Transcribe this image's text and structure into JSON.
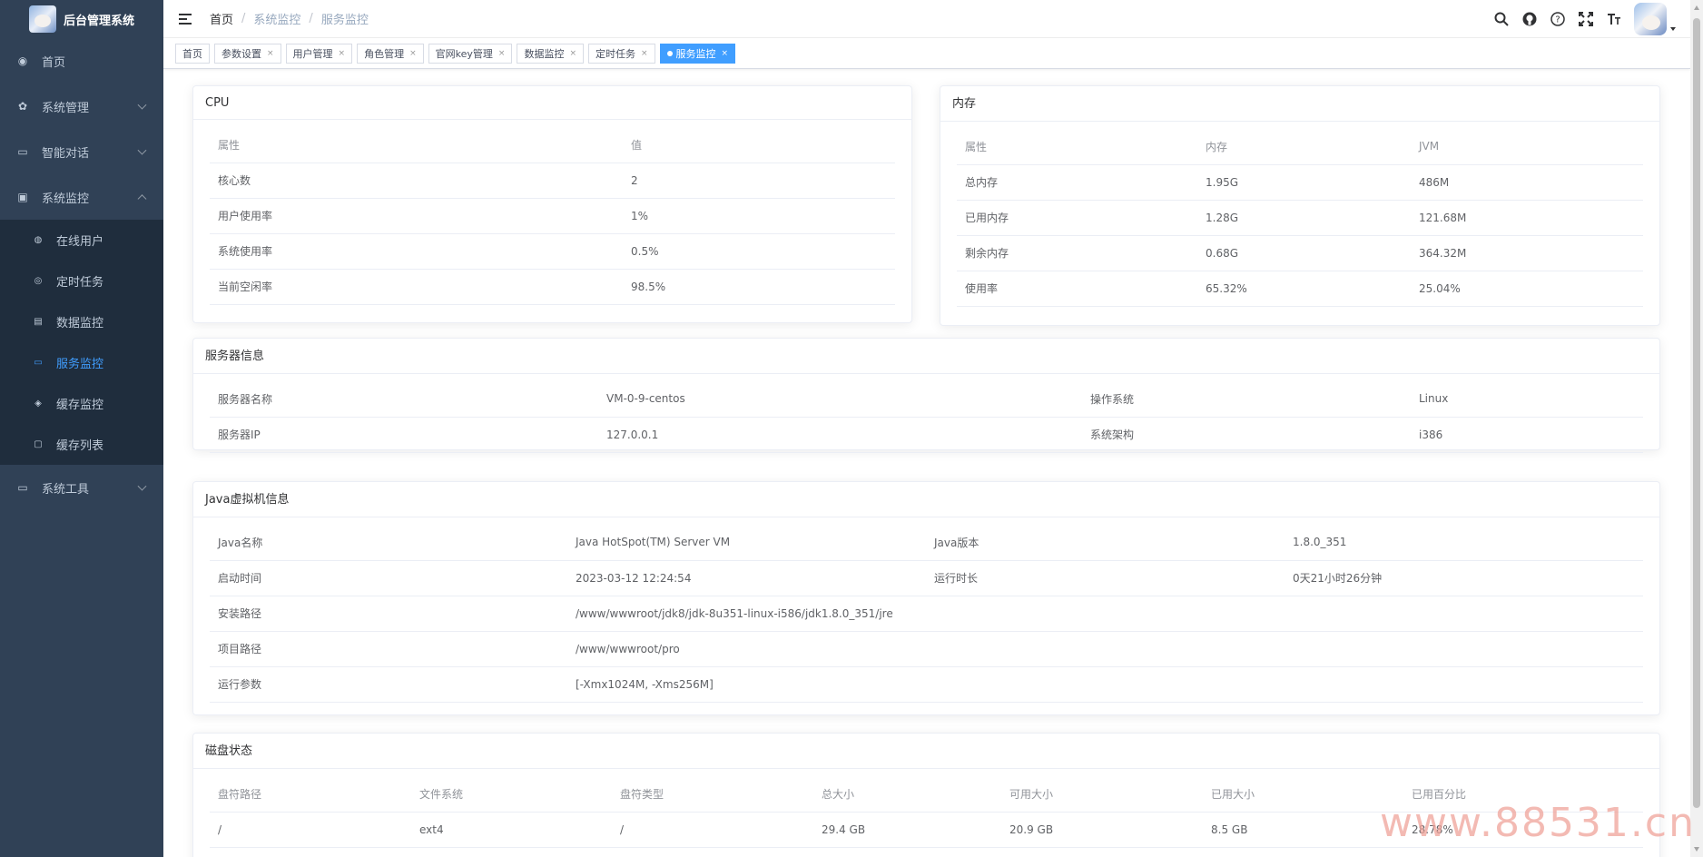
{
  "sidebar": {
    "logo_title": "后台管理系统",
    "menu": [
      {
        "label": "首页",
        "icon": "dashboard-icon"
      },
      {
        "label": "系统管理",
        "icon": "gear-icon"
      },
      {
        "label": "智能对话",
        "icon": "chat-icon"
      },
      {
        "label": "系统监控",
        "icon": "monitor-icon"
      },
      {
        "label": "系统工具",
        "icon": "tool-icon"
      }
    ],
    "monitor_children": [
      {
        "label": "在线用户",
        "icon": "online-icon"
      },
      {
        "label": "定时任务",
        "icon": "job-icon"
      },
      {
        "label": "数据监控",
        "icon": "druid-icon"
      },
      {
        "label": "服务监控",
        "icon": "server-icon"
      },
      {
        "label": "缓存监控",
        "icon": "redis-icon"
      },
      {
        "label": "缓存列表",
        "icon": "redis-list-icon"
      }
    ]
  },
  "breadcrumb": {
    "home": "首页",
    "parent": "系统监控",
    "current": "服务监控"
  },
  "tags": [
    {
      "label": "首页",
      "closable": false
    },
    {
      "label": "参数设置",
      "closable": true
    },
    {
      "label": "用户管理",
      "closable": true
    },
    {
      "label": "角色管理",
      "closable": true
    },
    {
      "label": "官网key管理",
      "closable": true
    },
    {
      "label": "数据监控",
      "closable": true
    },
    {
      "label": "定时任务",
      "closable": true
    },
    {
      "label": "服务监控",
      "closable": true,
      "active": true
    }
  ],
  "tag_close": "×",
  "cpu": {
    "title": "CPU",
    "headers": [
      "属性",
      "值"
    ],
    "rows": [
      [
        "核心数",
        "2"
      ],
      [
        "用户使用率",
        "1%"
      ],
      [
        "系统使用率",
        "0.5%"
      ],
      [
        "当前空闲率",
        "98.5%"
      ]
    ]
  },
  "memory": {
    "title": "内存",
    "headers": [
      "属性",
      "内存",
      "JVM"
    ],
    "rows": [
      [
        "总内存",
        "1.95G",
        "486M"
      ],
      [
        "已用内存",
        "1.28G",
        "121.68M"
      ],
      [
        "剩余内存",
        "0.68G",
        "364.32M"
      ],
      [
        "使用率",
        "65.32%",
        "25.04%"
      ]
    ]
  },
  "server": {
    "title": "服务器信息",
    "rows": [
      [
        "服务器名称",
        "VM-0-9-centos",
        "操作系统",
        "Linux"
      ],
      [
        "服务器IP",
        "127.0.0.1",
        "系统架构",
        "i386"
      ]
    ]
  },
  "jvm": {
    "title": "Java虚拟机信息",
    "rows4": [
      [
        "Java名称",
        "Java HotSpot(TM) Server VM",
        "Java版本",
        "1.8.0_351"
      ],
      [
        "启动时间",
        "2023-03-12 12:24:54",
        "运行时长",
        "0天21小时26分钟"
      ]
    ],
    "rows2": [
      [
        "安装路径",
        "/www/wwwroot/jdk8/jdk-8u351-linux-i586/jdk1.8.0_351/jre"
      ],
      [
        "项目路径",
        "/www/wwwroot/pro"
      ],
      [
        "运行参数",
        "[-Xmx1024M, -Xms256M]"
      ]
    ]
  },
  "disk": {
    "title": "磁盘状态",
    "headers": [
      "盘符路径",
      "文件系统",
      "盘符类型",
      "总大小",
      "可用大小",
      "已用大小",
      "已用百分比"
    ],
    "rows": [
      [
        "/",
        "ext4",
        "/",
        "29.4 GB",
        "20.9 GB",
        "8.5 GB",
        "28.78%"
      ]
    ]
  },
  "watermark": "www.88531.cn",
  "colors": {
    "sidebar_bg": "#304156",
    "submenu_bg": "#1f2d3d",
    "accent": "#409eff"
  }
}
